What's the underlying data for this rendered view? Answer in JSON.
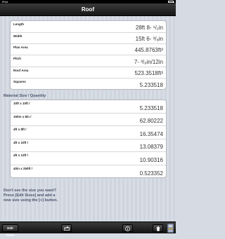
{
  "status_bar": {
    "carrier": "iPad",
    "time": ""
  },
  "nav": {
    "title": "Roof"
  },
  "measurements": [
    {
      "label": "Length",
      "value": "28ft 8- ¹/₂in"
    },
    {
      "label": "Width",
      "value": "15ft 6- ³/₈in"
    },
    {
      "label": "Plan Area",
      "value": "445.8763ft²"
    },
    {
      "label": "Pitch",
      "value": "7- ³/₈in/12in"
    },
    {
      "label": "Roof Area",
      "value": "523.3518ft²"
    },
    {
      "label": "Squares",
      "value": "5.233518"
    }
  ],
  "material_section": {
    "header": "Material Size / Quantity",
    "rows": [
      {
        "label": "10ft x 10ft /",
        "value": "5.233518"
      },
      {
        "label": "150in x 8in /",
        "value": "62.80222"
      },
      {
        "label": "4ft x 8ft /",
        "value": "16.35474"
      },
      {
        "label": "4ft x 10ft /",
        "value": "13.08379"
      },
      {
        "label": "4ft x 12ft /",
        "value": "10.90316"
      },
      {
        "label": "40in x 250ft /",
        "value": "0.523352"
      }
    ]
  },
  "note": {
    "line1": "Don't see the size you want?",
    "line2": "Press [Edit Sizes] and add a",
    "line3": "new size using the [+] button."
  },
  "toolbar": {
    "edit_sizes_label": "Edit Sizes",
    "share_icon": "share-icon",
    "info_icon": "info-icon",
    "trash_icon": "trash-icon",
    "logo_icon": "app-logo-icon"
  }
}
